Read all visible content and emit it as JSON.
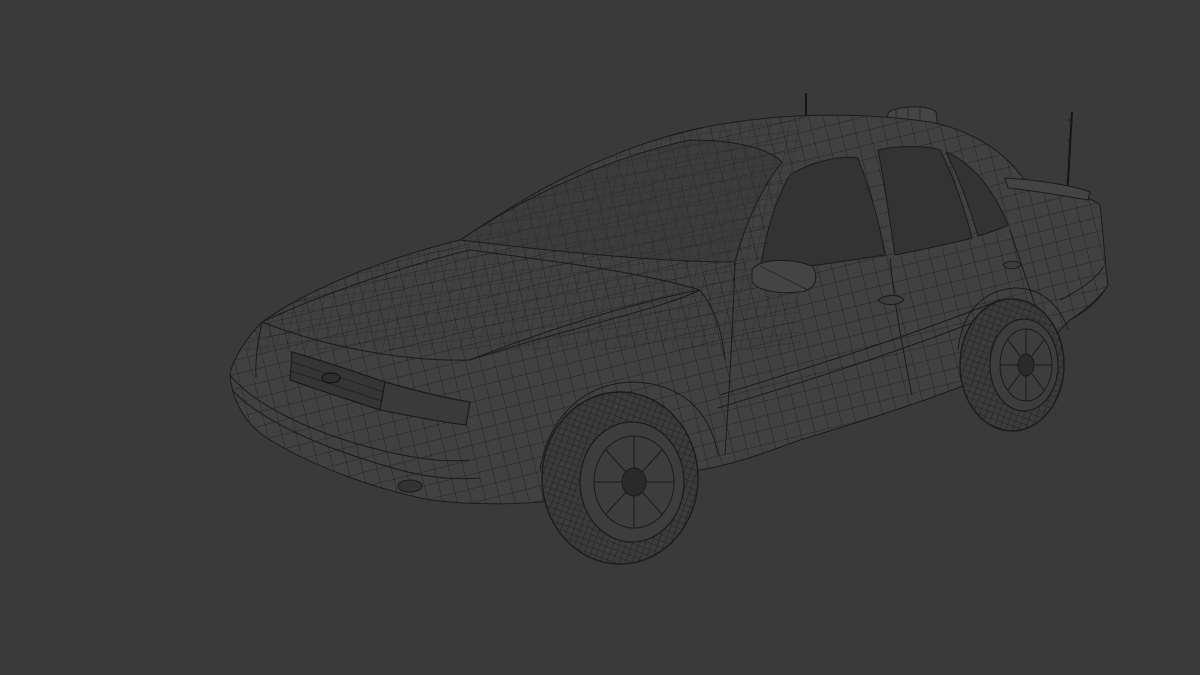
{
  "scene": {
    "subject": "car-wireframe-mesh",
    "background_color": "#3a3a3a",
    "wire_color": "#1b1b1b",
    "body_color": "#414141",
    "glass_color": "#333333"
  }
}
